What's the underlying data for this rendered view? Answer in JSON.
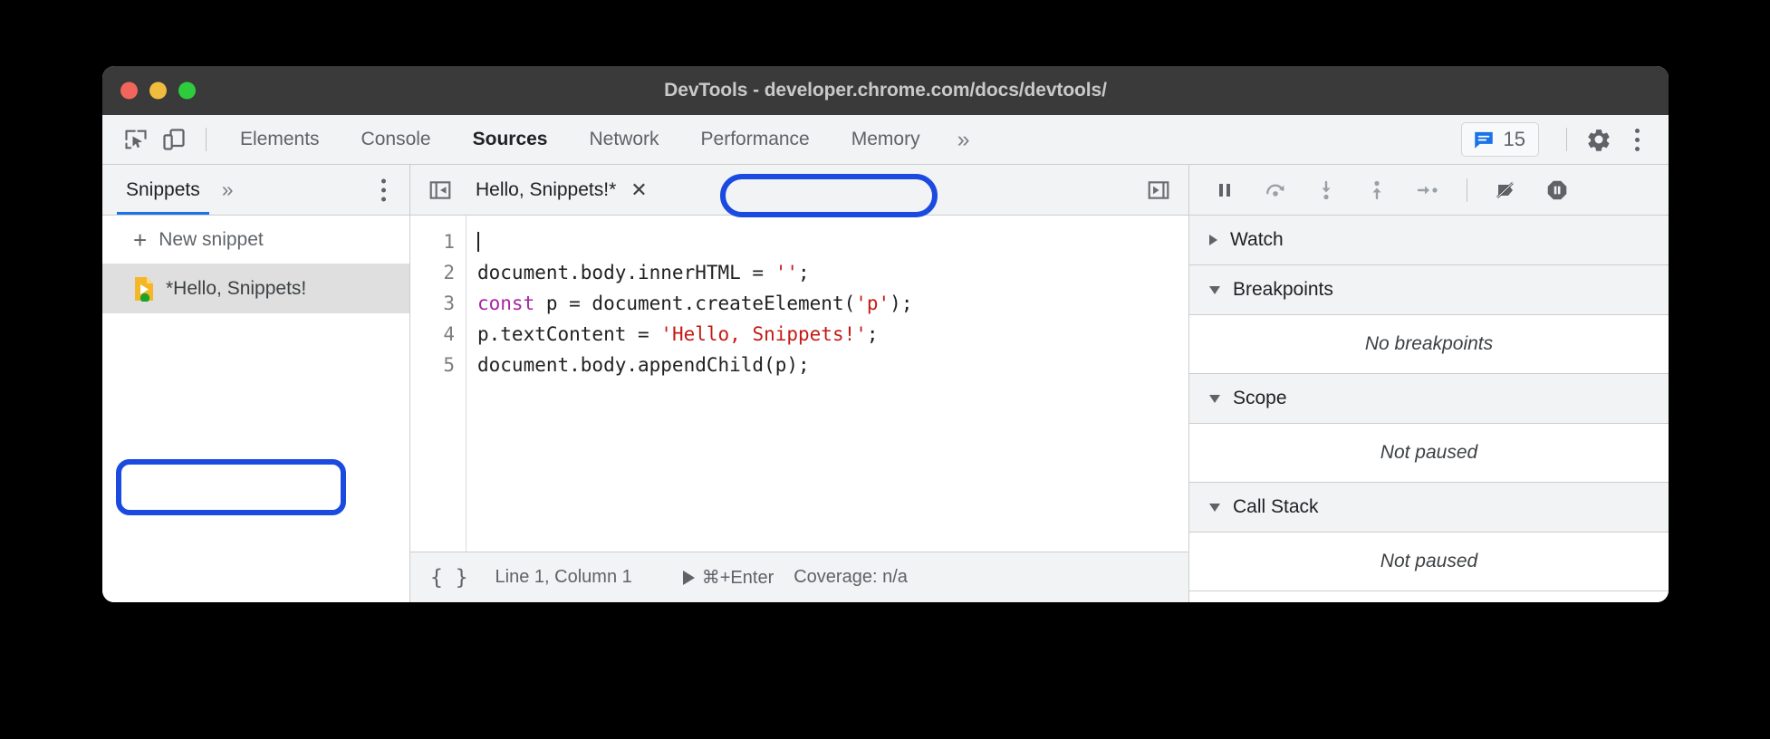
{
  "window": {
    "title": "DevTools - developer.chrome.com/docs/devtools/",
    "traffic_lights": [
      "close",
      "minimize",
      "maximize"
    ]
  },
  "toolbar": {
    "inspect_icon": "inspect-element-icon",
    "device_icon": "device-toolbar-icon",
    "tabs": [
      {
        "label": "Elements",
        "active": false
      },
      {
        "label": "Console",
        "active": false
      },
      {
        "label": "Sources",
        "active": true
      },
      {
        "label": "Network",
        "active": false
      },
      {
        "label": "Performance",
        "active": false
      },
      {
        "label": "Memory",
        "active": false
      }
    ],
    "more_tabs_label": "»",
    "issues": {
      "icon": "issues-message-icon",
      "count": "15",
      "color": "#1a73e8"
    },
    "settings_icon": "gear-icon",
    "kebab_icon": "more-options-icon"
  },
  "sidebar": {
    "tab_label": "Snippets",
    "more_label": "»",
    "kebab_icon": "navigator-more-options-icon",
    "new_snippet_label": "New snippet",
    "plus_glyph": "+",
    "snippets": [
      {
        "name": "*Hello, Snippets!",
        "icon": "snippet-file-icon",
        "selected": true,
        "status": "unsaved"
      }
    ],
    "accent": "#1a73e8",
    "highlight_ring_color": "#1a4ae0"
  },
  "editor": {
    "collapse_sidebar_icon": "show-navigator-icon",
    "show_debugger_icon": "show-debugger-icon",
    "tab": {
      "label": "Hello, Snippets!*",
      "close_glyph": "✕"
    },
    "line_numbers": [
      "1",
      "2",
      "3",
      "4",
      "5"
    ],
    "code_lines": [
      {
        "tokens": [
          {
            "t": "caret",
            "v": ""
          }
        ]
      },
      {
        "tokens": [
          {
            "t": "plain",
            "v": "document.body.innerHTML = "
          },
          {
            "t": "str",
            "v": "''"
          },
          {
            "t": "plain",
            "v": ";"
          }
        ]
      },
      {
        "tokens": [
          {
            "t": "kw",
            "v": "const"
          },
          {
            "t": "plain",
            "v": " p = document.createElement("
          },
          {
            "t": "str",
            "v": "'p'"
          },
          {
            "t": "plain",
            "v": ");"
          }
        ]
      },
      {
        "tokens": [
          {
            "t": "plain",
            "v": "p.textContent = "
          },
          {
            "t": "str",
            "v": "'Hello, Snippets!'"
          },
          {
            "t": "plain",
            "v": ";"
          }
        ]
      },
      {
        "tokens": [
          {
            "t": "plain",
            "v": "document.body.appendChild(p);"
          }
        ]
      }
    ],
    "keyword_color": "#a626a4",
    "string_color": "#c41a16"
  },
  "statusbar": {
    "format_icon": "{ }",
    "position": "Line 1, Column 1",
    "run_shortcut": "⌘+Enter",
    "run_icon": "run-snippet-icon",
    "coverage": "Coverage: n/a"
  },
  "debugger": {
    "controls": [
      {
        "name": "resume-script-execution-icon",
        "title": "pause"
      },
      {
        "name": "step-over-next-function-call-icon",
        "title": "step over"
      },
      {
        "name": "step-into-next-function-call-icon",
        "title": "step into"
      },
      {
        "name": "step-out-of-current-function-icon",
        "title": "step out"
      },
      {
        "name": "step-icon",
        "title": "step"
      },
      {
        "name": "deactivate-breakpoints-icon",
        "title": "deactivate breakpoints"
      },
      {
        "name": "pause-on-exceptions-icon",
        "title": "pause on exceptions"
      }
    ],
    "sections": [
      {
        "label": "Watch",
        "expanded": false,
        "body": null
      },
      {
        "label": "Breakpoints",
        "expanded": true,
        "body": "No breakpoints"
      },
      {
        "label": "Scope",
        "expanded": true,
        "body": "Not paused"
      },
      {
        "label": "Call Stack",
        "expanded": true,
        "body": "Not paused"
      }
    ]
  }
}
